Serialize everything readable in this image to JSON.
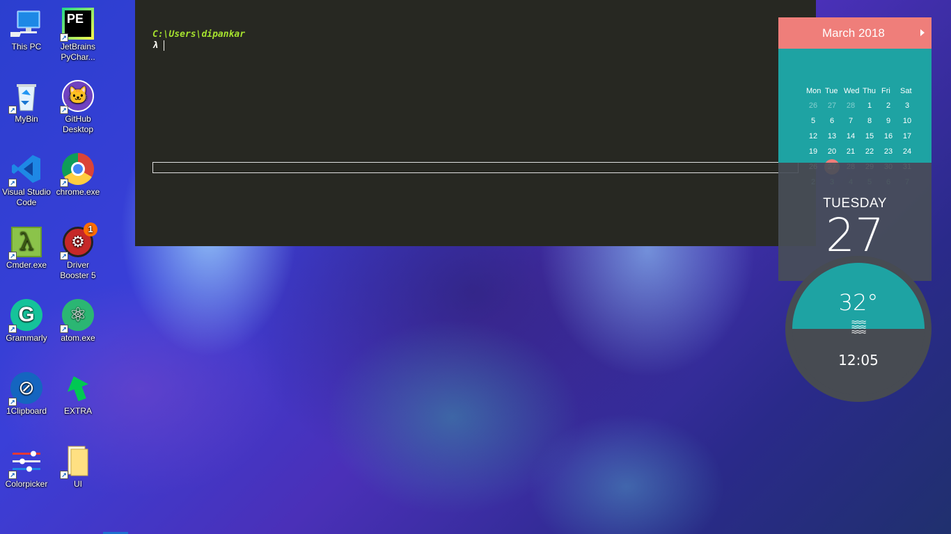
{
  "desktop": {
    "icons": [
      {
        "label": "This PC"
      },
      {
        "label": "JetBrains PyChar..."
      },
      {
        "label": "MyBin"
      },
      {
        "label": "GitHub Desktop"
      },
      {
        "label": "Visual Studio Code"
      },
      {
        "label": "chrome.exe"
      },
      {
        "label": "Cmder.exe"
      },
      {
        "label": "Driver Booster 5",
        "badge": "1"
      },
      {
        "label": "Grammarly"
      },
      {
        "label": "atom.exe"
      },
      {
        "label": "1Clipboard"
      },
      {
        "label": "EXTRA"
      },
      {
        "label": "Colorpicker"
      },
      {
        "label": "UI"
      }
    ],
    "pycharm_logo_text": "PE"
  },
  "terminal": {
    "path": "C:\\Users\\dipankar",
    "prompt": "λ"
  },
  "calendar": {
    "month_title": "March 2018",
    "weekdays": [
      "Mon",
      "Tue",
      "Wed",
      "Thu",
      "Fri",
      "Sat"
    ],
    "weeks": [
      [
        "26",
        "27",
        "28",
        "1",
        "2",
        "3"
      ],
      [
        "5",
        "6",
        "7",
        "8",
        "9",
        "10"
      ],
      [
        "12",
        "13",
        "14",
        "15",
        "16",
        "17"
      ],
      [
        "19",
        "20",
        "21",
        "22",
        "23",
        "24"
      ],
      [
        "26",
        "27",
        "28",
        "29",
        "30",
        "31"
      ],
      [
        "2",
        "3",
        "4",
        "5",
        "6",
        "7"
      ]
    ],
    "today": "27",
    "weekday_name": "TUESDAY",
    "day_number": "27",
    "colors": {
      "header": "#ef7e7a",
      "body": "#1ea3a3",
      "panel": "#484e58"
    }
  },
  "weather": {
    "temperature": "32°",
    "time": "12:05"
  }
}
